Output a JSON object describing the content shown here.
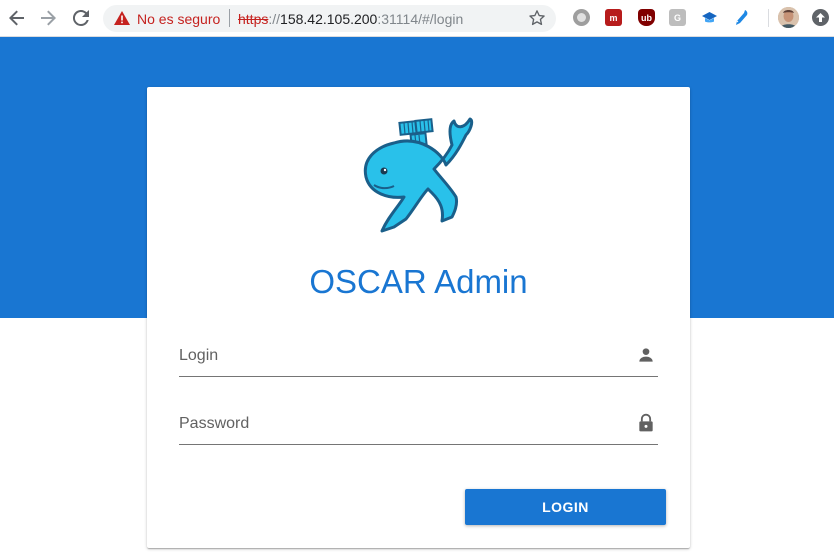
{
  "browser": {
    "security_label": "No es seguro",
    "url_scheme": "https",
    "url_sep": "://",
    "url_host": "158.42.105.200",
    "url_rest": ":31114/#/login",
    "icons": [
      "back-icon",
      "forward-icon",
      "reload-icon",
      "warning-icon",
      "star-icon",
      "extension-icons",
      "profile-avatar",
      "update-icon"
    ]
  },
  "page": {
    "title": "OSCAR Admin",
    "login_label": "Login",
    "password_label": "Password",
    "submit_label": "LOGIN"
  },
  "colors": {
    "primary": "#1976d2",
    "logo": "#29c1ea"
  }
}
